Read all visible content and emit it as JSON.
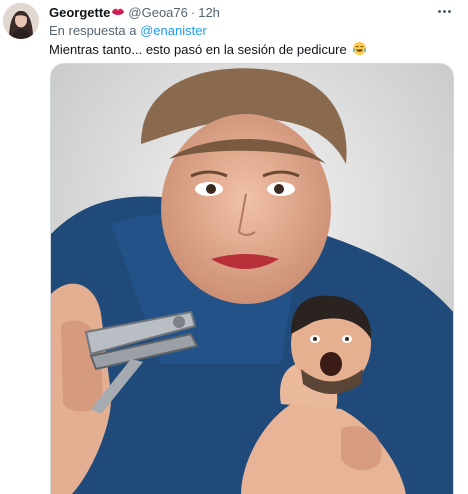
{
  "tweet": {
    "display_name": "Georgette",
    "name_emoji_icon": "kiss-lips-icon",
    "handle": "@Geoa76",
    "separator": "·",
    "time": "12h",
    "more_icon": "more-options-icon",
    "reply_prefix": "En respuesta a",
    "reply_to": "@enanister",
    "text": "Mientras tanto... esto pasó en la sesión de pedicure",
    "text_emoji_icon": "tears-of-joy-emoji-icon",
    "media_icon": "meme-photo-image"
  },
  "colors": {
    "link": "#1d9bf0",
    "secondary_text": "#536471",
    "primary_text": "#0f1419",
    "border": "#cfd9de"
  }
}
